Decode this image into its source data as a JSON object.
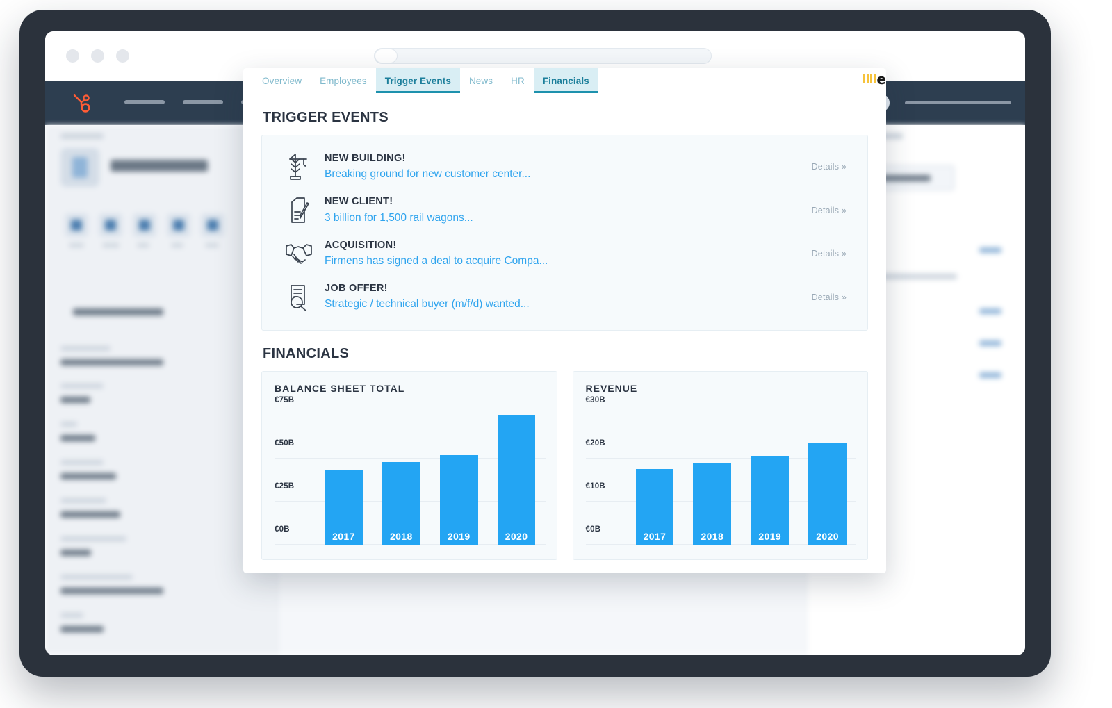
{
  "browser": {
    "window_controls": [
      "close",
      "minimize",
      "maximize"
    ],
    "address_value": ""
  },
  "crm_nav": {
    "logo": "hubspot-logo",
    "links_count": 6,
    "icon_count": 4
  },
  "modal": {
    "logo_text": "e",
    "tabs": [
      {
        "label": "Overview",
        "active": false
      },
      {
        "label": "Employees",
        "active": false
      },
      {
        "label": "Trigger Events",
        "active": true
      },
      {
        "label": "News",
        "active": false
      },
      {
        "label": "HR",
        "active": false
      },
      {
        "label": "Financials",
        "active": true
      }
    ],
    "trigger_events": {
      "heading": "TRIGGER EVENTS",
      "items": [
        {
          "icon": "crane-icon",
          "title": "NEW BUILDING!",
          "subtitle": "Breaking ground for new customer center...",
          "details_label": "Details »"
        },
        {
          "icon": "clipboard-pen-icon",
          "title": "NEW CLIENT!",
          "subtitle": "3 billion for 1,500 rail wagons...",
          "details_label": "Details »"
        },
        {
          "icon": "handshake-icon",
          "title": "ACQUISITION!",
          "subtitle": "Firmens has signed a deal to acquire Compa...",
          "details_label": "Details »"
        },
        {
          "icon": "document-magnifier-icon",
          "title": "JOB OFFER!",
          "subtitle": "Strategic / technical buyer (m/f/d) wanted...",
          "details_label": "Details »"
        }
      ]
    },
    "financials": {
      "heading": "FINANCIALS"
    }
  },
  "colors": {
    "bar": "#23a5f3",
    "link": "#2fa4ee",
    "tab_active_bg": "#d9eef4",
    "tab_active_text": "#1c7f9b",
    "tab_underline": "#1d91ad",
    "nav_bg": "#2d3e50",
    "hubspot_orange": "#ff5c35",
    "logo_yellow": "#f6c33c",
    "device_bezel": "#2b323c"
  },
  "chart_data": [
    {
      "type": "bar",
      "title": "BALANCE SHEET TOTAL",
      "categories": [
        "2017",
        "2018",
        "2019",
        "2020"
      ],
      "values": [
        43,
        48,
        52,
        75
      ],
      "xlabel": "",
      "ylabel": "",
      "ylim": [
        0,
        85
      ],
      "yticks": [
        0,
        25,
        50,
        75
      ],
      "ytick_labels": [
        "€0B",
        "€25B",
        "€50B",
        "€75B"
      ],
      "grid": true,
      "legend": "none",
      "bar_color": "#23a5f3",
      "data_labels_inside_bars": [
        "2017",
        "2018",
        "2019",
        "2020"
      ]
    },
    {
      "type": "bar",
      "title": "REVENUE",
      "categories": [
        "2017",
        "2018",
        "2019",
        "2020"
      ],
      "values": [
        17.5,
        19,
        20.5,
        23.5
      ],
      "xlabel": "",
      "ylabel": "",
      "ylim": [
        0,
        34
      ],
      "yticks": [
        0,
        10,
        20,
        30
      ],
      "ytick_labels": [
        "€0B",
        "€10B",
        "€20B",
        "€30B"
      ],
      "grid": true,
      "legend": "none",
      "bar_color": "#23a5f3",
      "data_labels_inside_bars": [
        "2017",
        "2018",
        "2019",
        "2020"
      ]
    }
  ]
}
